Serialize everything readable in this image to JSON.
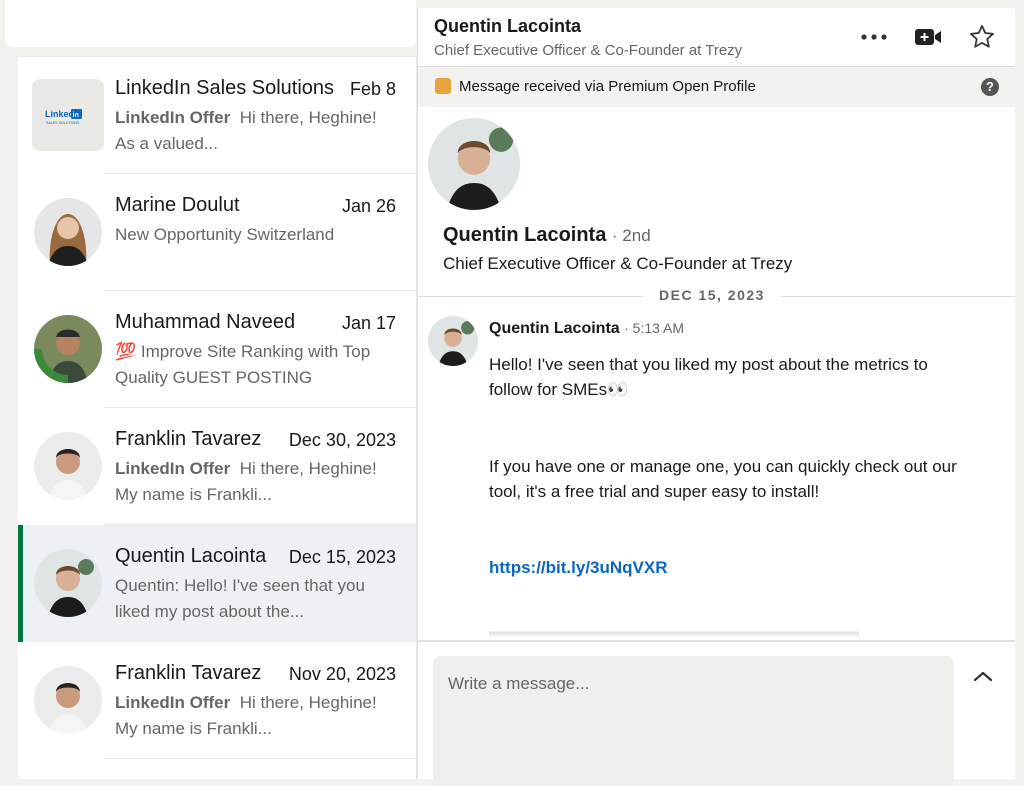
{
  "conversations": [
    {
      "name": "LinkedIn Sales Solutions",
      "date": "Feb 8",
      "snippet_prefix": "LinkedIn Offer",
      "snippet": "Hi there, Heghine! As a valued...",
      "avatar": "LinkedIn",
      "avatar_sub": "SALES SOLUTIONS"
    },
    {
      "name": "Marine Doulut",
      "date": "Jan 26",
      "snippet_prefix": "",
      "snippet": "New Opportunity Switzerland"
    },
    {
      "name": "Muhammad Naveed",
      "date": "Jan 17",
      "snippet_prefix": "",
      "snippet": "💯 Improve Site Ranking with Top Quality GUEST POSTING",
      "avatar_badge": "#OPENTOWORK"
    },
    {
      "name": "Franklin Tavarez",
      "date": "Dec 30, 2023",
      "snippet_prefix": "LinkedIn Offer",
      "snippet": "Hi there, Heghine! My name is Frankli..."
    },
    {
      "name": "Quentin Lacointa",
      "date": "Dec 15, 2023",
      "snippet_prefix": "",
      "snippet": "Quentin: Hello! I've seen that you liked my post about the..."
    },
    {
      "name": "Franklin Tavarez",
      "date": "Nov 20, 2023",
      "snippet_prefix": "LinkedIn Offer",
      "snippet": "Hi there, Heghine! My name is Frankli..."
    }
  ],
  "header": {
    "name": "Quentin Lacointa",
    "title": "Chief Executive Officer & Co-Founder at Trezy"
  },
  "premium_bar": {
    "text": "Message received via Premium Open Profile",
    "help": "?"
  },
  "profile": {
    "name": "Quentin Lacointa",
    "degree": "· 2nd",
    "title": "Chief Executive Officer & Co-Founder at Trezy"
  },
  "thread": {
    "date": "DEC 15, 2023",
    "sender": "Quentin Lacointa",
    "time": "· 5:13 AM",
    "para1": "Hello! I've seen that you liked my post about the metrics to follow for SMEs👀",
    "para2": "If you have one or manage one, you can quickly check out our tool, it's a free trial and super easy to install!",
    "link": "https://bit.ly/3uNqVXR"
  },
  "composer": {
    "placeholder": "Write a message..."
  },
  "colors": {
    "accent_green": "#057642",
    "link_blue": "#0a66c2",
    "premium_gold": "#e7a33e",
    "active_bg": "#edf1f6"
  }
}
